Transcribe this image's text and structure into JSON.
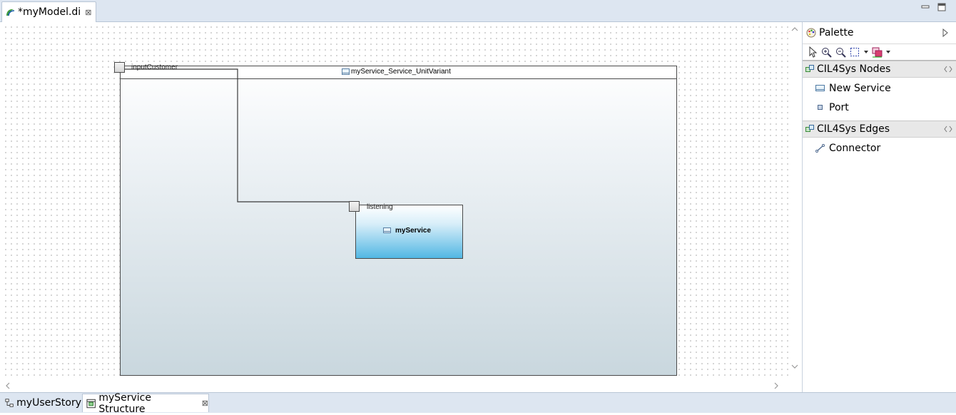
{
  "editor": {
    "tab_label": "*myModel.di",
    "tab_close": "⊠"
  },
  "diagram": {
    "container_title": "myService_Service_UnitVariant",
    "input_port_label": "inputCustomer",
    "listening_port_label": "listening",
    "service_title": "myService"
  },
  "palette": {
    "title": "Palette",
    "drawers": [
      {
        "label": "CIL4Sys Nodes",
        "items": [
          {
            "label": "New Service"
          },
          {
            "label": "Port"
          }
        ]
      },
      {
        "label": "CIL4Sys Edges",
        "items": [
          {
            "label": "Connector"
          }
        ]
      }
    ]
  },
  "bottom_tabs": [
    {
      "label": "myUserStory"
    },
    {
      "label": "myService Structure",
      "close": "⊠"
    }
  ]
}
